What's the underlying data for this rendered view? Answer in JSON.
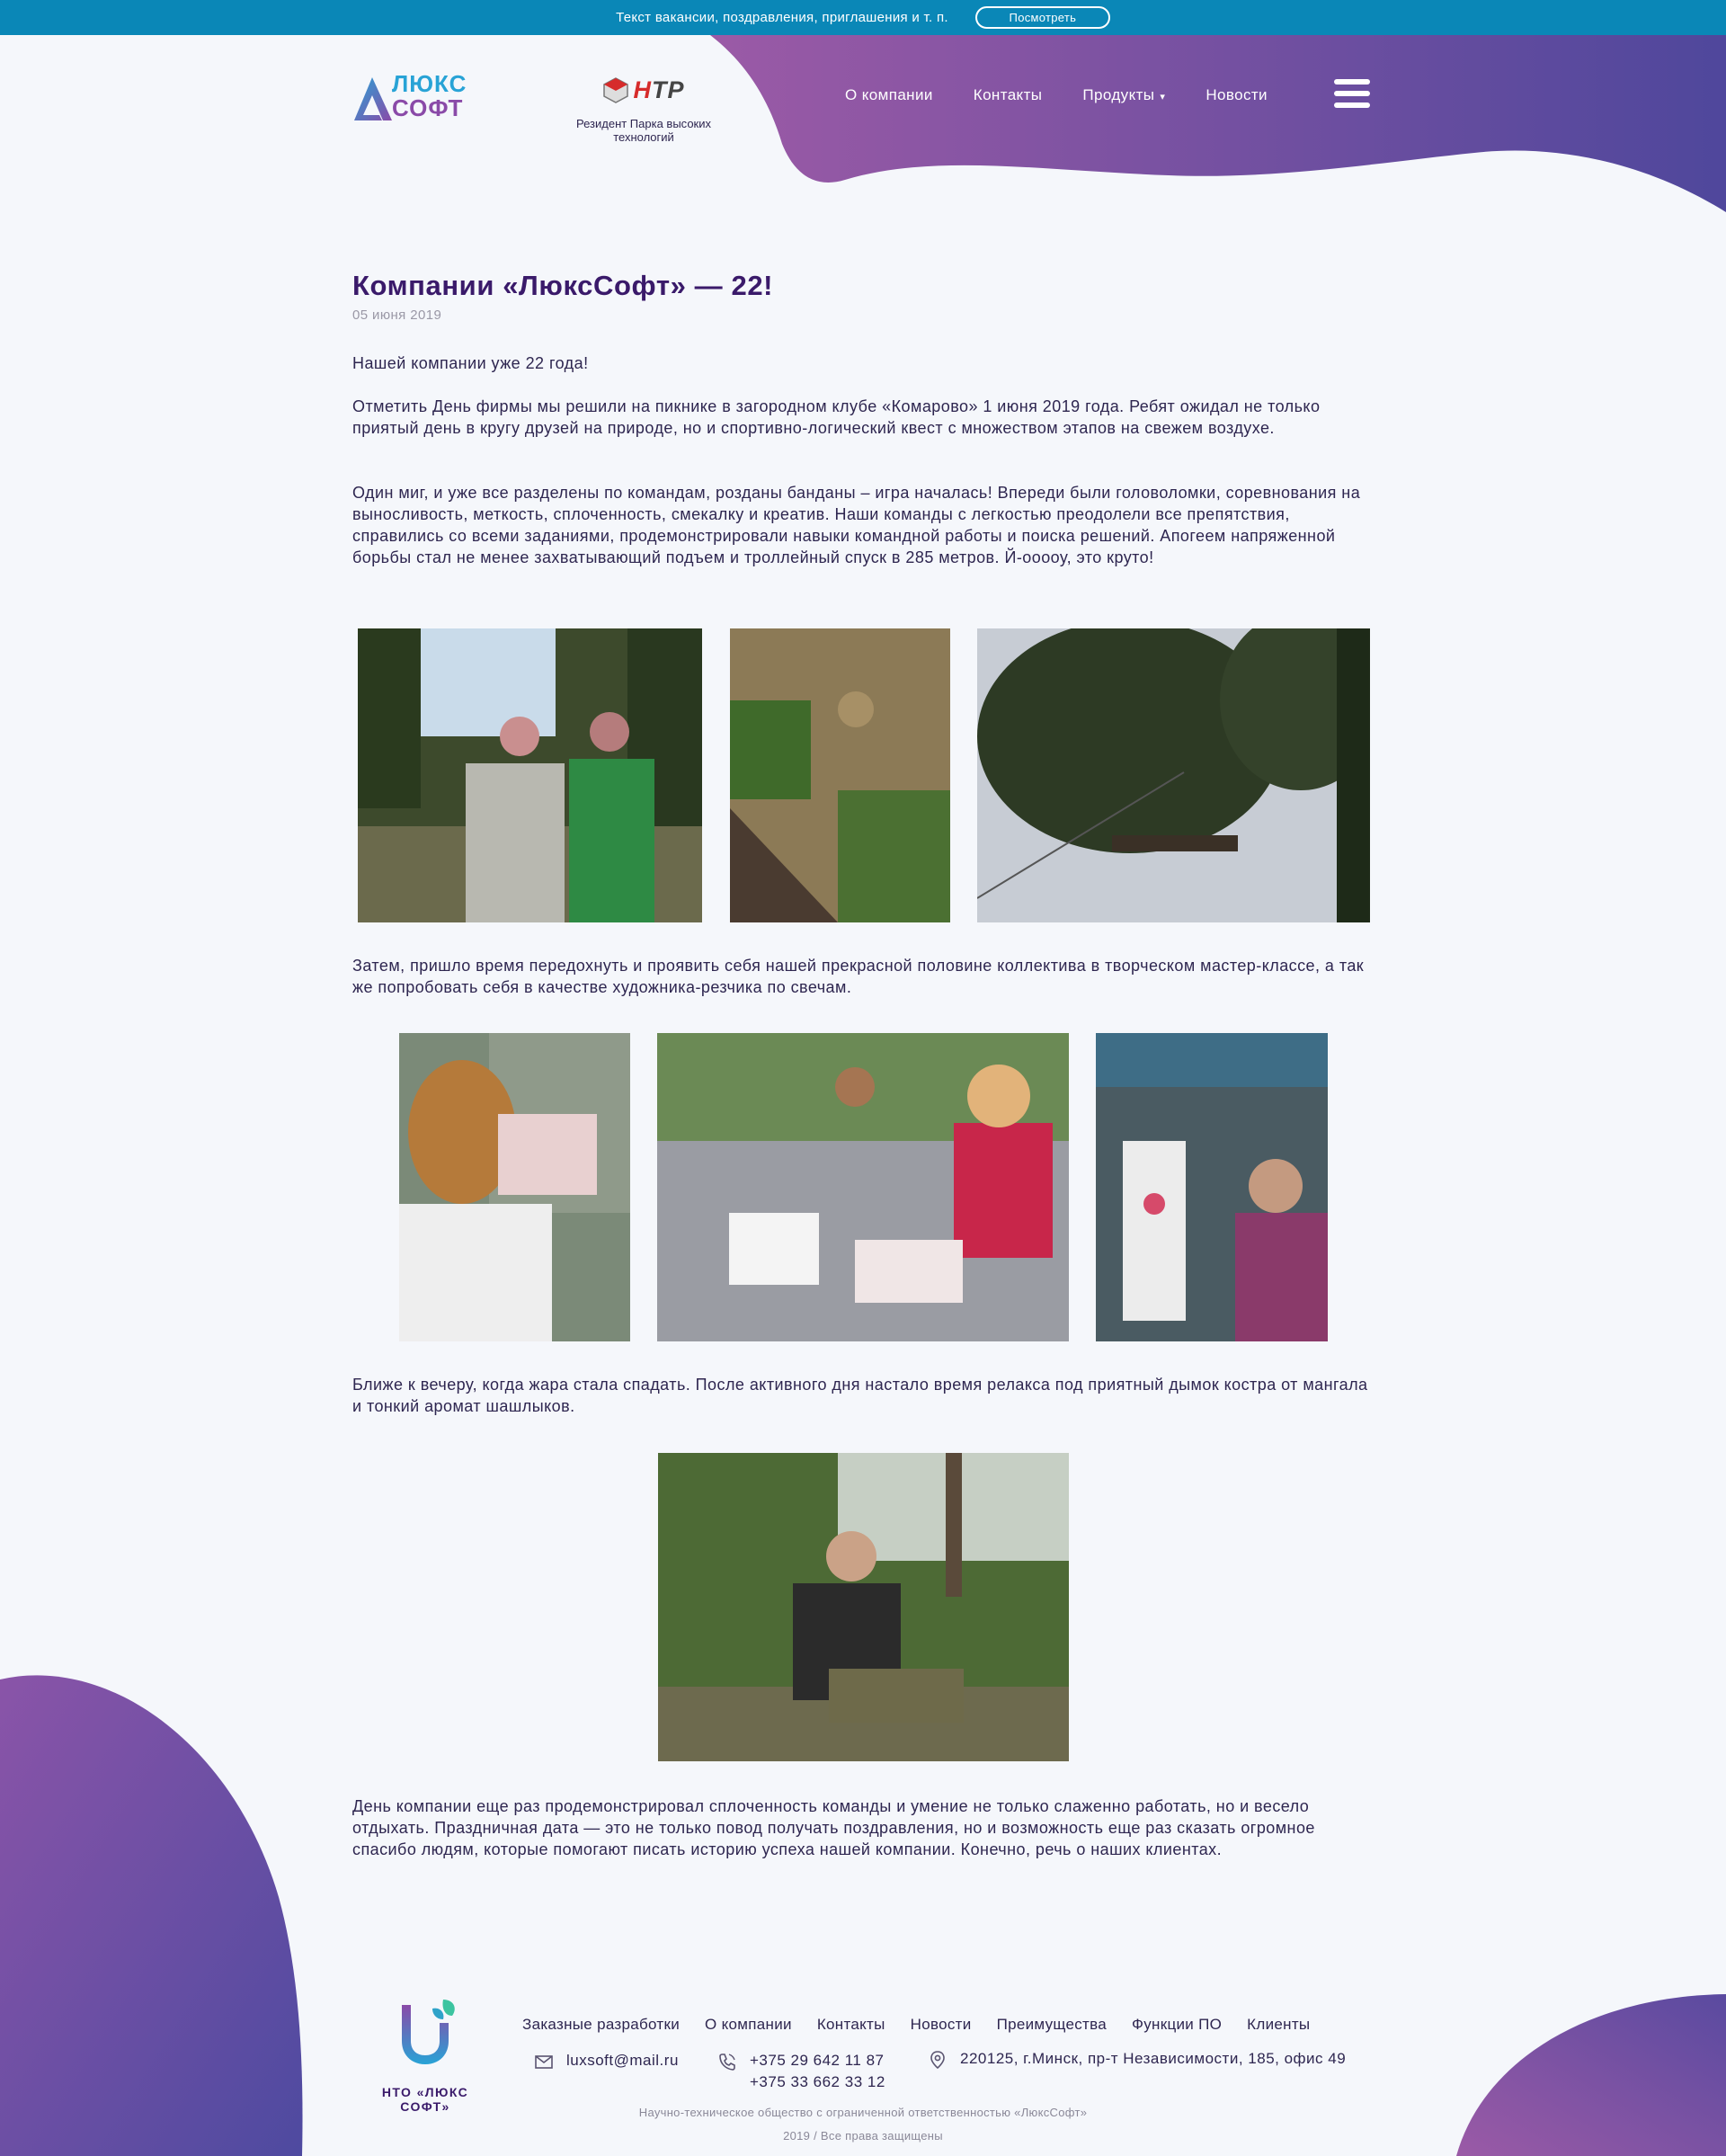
{
  "announcement": {
    "text": "Текст вакансии, поздравления, приглашения и т. п.",
    "button": "Посмотреть"
  },
  "brand": {
    "logo_line1": "ЛЮКС",
    "logo_line2": "СОФТ",
    "partner_logo": "НТР",
    "partner_caption": "Резидент Парка высоких технологий"
  },
  "nav": {
    "items": [
      "О компании",
      "Контакты",
      "Продукты",
      "Новости"
    ],
    "products_caret": "▾"
  },
  "article": {
    "title": "Компании «ЛюксСофт» — 22!",
    "date": "05 июня 2019",
    "paragraphs": [
      "Нашей компании уже 22 года!",
      "Отметить День фирмы мы решили на пикнике в загородном клубе «Комарово» 1 июня 2019 года. Ребят ожидал не только приятый день в кругу друзей на природе, но и спортивно-логический  квест с множеством этапов на свежем воздухе.",
      "Один миг, и уже все разделены по командам, розданы банданы – игра началась! Впереди были головоломки, соревнования на выносливость, меткость, сплоченность, смекалку и креатив. Наши команды с легкостью преодолели все препятствия, справились со всеми заданиями, продемонстрировали навыки командной работы и поиска решений. Апогеем напряженной борьбы стал не менее захватывающий подъем и троллейный спуск в 285 метров. Й-ооооу, это круто!",
      "Затем, пришло время передохнуть и проявить  себя нашей прекрасной половине коллектива  в творческом мастер-классе, а так же попробовать себя в качестве художника-резчика по свечам.",
      "Ближе к вечеру, когда жара стала спадать. После активного дня настало время релакса под приятный дымок костра от мангала и тонкий аромат шашлыков.",
      "День компании еще раз продемонстрировал сплоченность команды и умение не только слаженно работать, но и весело отдыхать.    Праздничная дата — это не только повод получать поздравления, но и возможность еще раз сказать огромное спасибо людям, которые помогают писать историю успеха нашей компании. Конечно, речь о наших клиентах."
    ]
  },
  "footer": {
    "company_name": "НТО «ЛЮКС СОФТ»",
    "nav": [
      "Заказные разработки",
      "О компании",
      "Контакты",
      "Новости",
      "Преимущества",
      "Функции ПО",
      "Клиенты"
    ],
    "email": "luxsoft@mail.ru",
    "phone1": "+375 29 642 11 87",
    "phone2": "+375 33 662 33 12",
    "address": "220125, г.Минск, пр-т Независимости, 185, офис 49",
    "legal": "Научно-техническое общество с ограниченной ответственностью «ЛюксСофт»",
    "copyright": "2019 / Все права защищены"
  },
  "icons": {
    "menu": "hamburger-icon",
    "email": "envelope-icon",
    "phone": "phone-icon",
    "address": "map-pin-icon"
  },
  "colors": {
    "accent_blue": "#0a87b7",
    "purple_dark": "#52469c",
    "purple_light": "#8e5aa8",
    "title": "#3a1a6a",
    "text": "#2e2650"
  }
}
